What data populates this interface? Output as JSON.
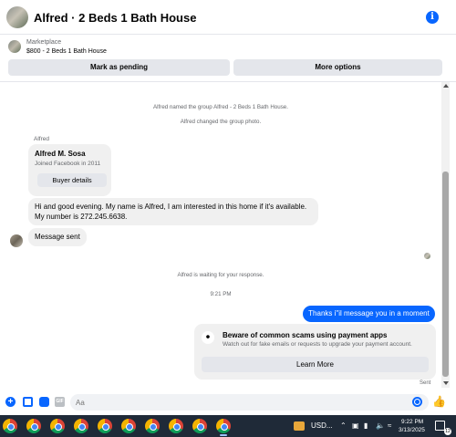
{
  "header": {
    "title": "Alfred · 2 Beds 1 Bath House",
    "info_icon": "i"
  },
  "marketplace": {
    "label": "Marketplace",
    "listing": "$800 - 2 Beds 1 Bath House",
    "mark_pending": "Mark as pending",
    "more_options": "More options"
  },
  "chat": {
    "system": [
      "Alfred named the group Alfred - 2 Beds 1 Bath House.",
      "Alfred changed the group photo.",
      "Alfred is waiting for your response.",
      "9:21 PM"
    ],
    "sender": "Alfred",
    "profile_card": {
      "name": "Alfred M. Sosa",
      "joined": "Joined Facebook in 2011",
      "buyer_details": "Buyer details"
    },
    "incoming": [
      "Hi and good evening. My name is Alfred, I am interested in this home if it's available. My number is 272.245.6638.",
      "Message sent"
    ],
    "outgoing": "Thanks i\"il message you in a moment",
    "warning": {
      "title": "Beware of common scams using payment apps",
      "body": "Watch out for fake emails or requests to upgrade your payment account.",
      "learn_more": "Learn More"
    },
    "status": "Sent"
  },
  "composer": {
    "placeholder": "Aa",
    "gif_label": "GIF"
  },
  "taskbar": {
    "currency": "USD...",
    "time": "9:22 PM",
    "date": "3/13/2025",
    "notification_count": "12"
  },
  "colors": {
    "accent": "#0866ff",
    "bubble": "#f0f0f0",
    "taskbar": "#1f2a38"
  }
}
